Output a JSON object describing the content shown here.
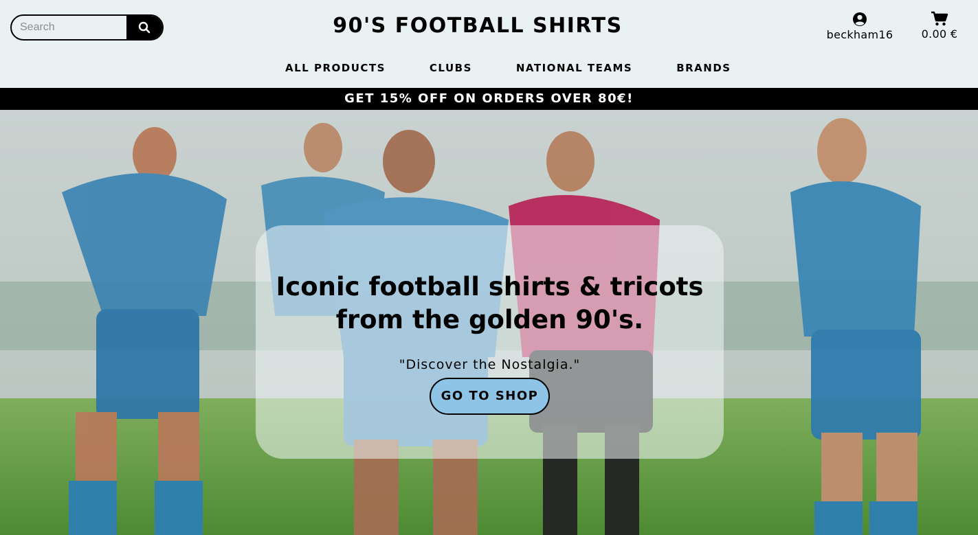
{
  "header": {
    "search_placeholder": "Search",
    "site_title": "90'S FOOTBALL SHIRTS",
    "account_username": "beckham16",
    "cart_total": "0.00 €"
  },
  "nav": {
    "items": [
      {
        "label": "ALL PRODUCTS"
      },
      {
        "label": "CLUBS"
      },
      {
        "label": "NATIONAL TEAMS"
      },
      {
        "label": "BRANDS"
      }
    ]
  },
  "promo": {
    "text": "GET 15% OFF ON ORDERS OVER 80€!"
  },
  "hero": {
    "headline": "Iconic football shirts & tricots from the golden 90's.",
    "tagline": "\"Discover the Nostalgia.\"",
    "cta_label": "GO TO SHOP"
  },
  "icons": {
    "search": "search-icon",
    "account": "user-circle-icon",
    "cart": "shopping-cart-icon"
  },
  "colors": {
    "header_bg": "#eaf1f2",
    "promo_bg": "#000000",
    "cta_bg": "#8ec4e6",
    "text": "#000000"
  }
}
